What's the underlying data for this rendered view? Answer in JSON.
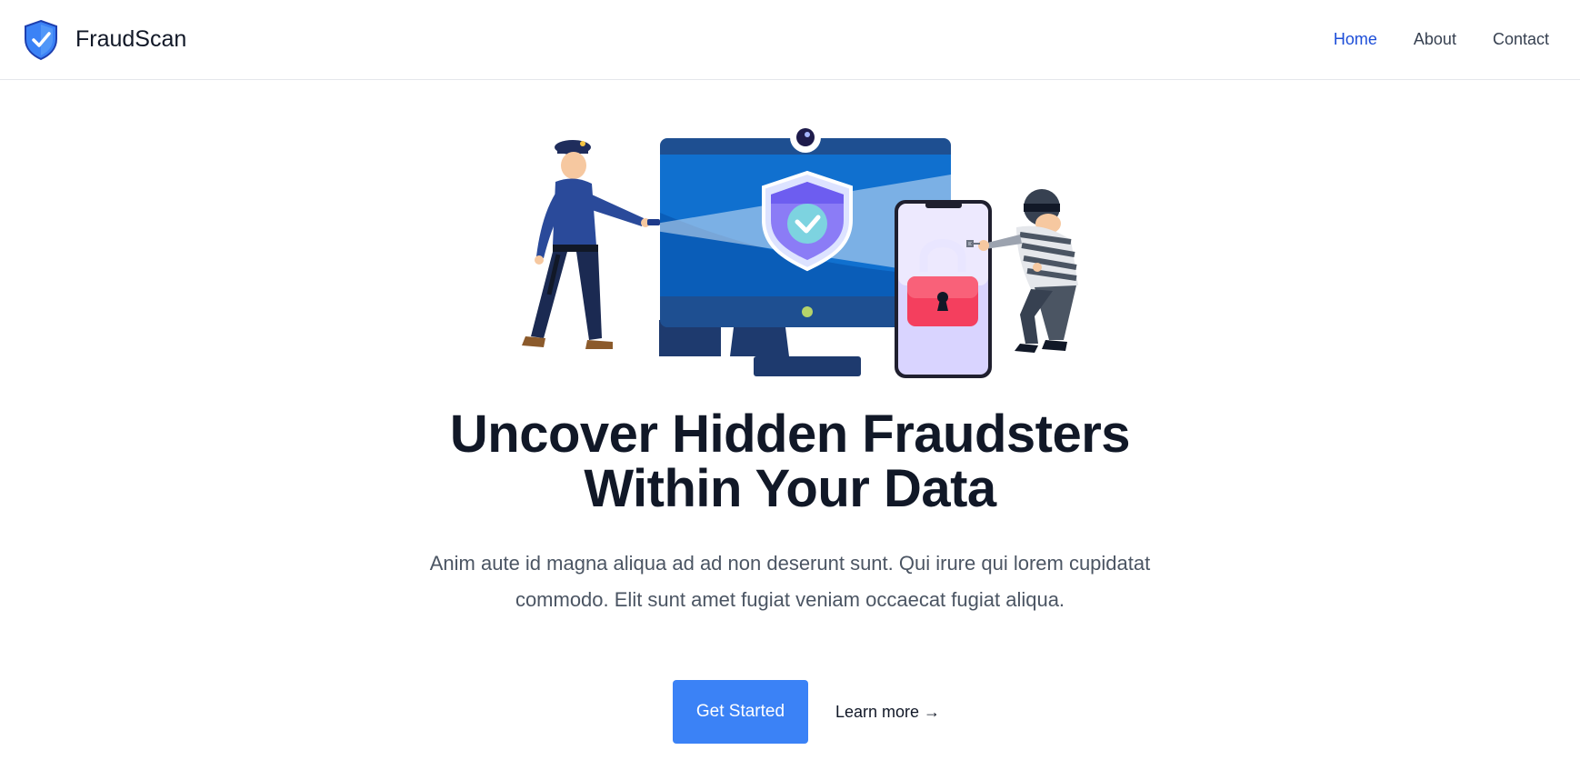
{
  "brand": {
    "name": "FraudScan",
    "logo_icon": "shield-check-icon",
    "accent": "#3b82f6"
  },
  "nav": {
    "items": [
      {
        "label": "Home",
        "active": true
      },
      {
        "label": "About",
        "active": false
      },
      {
        "label": "Contact",
        "active": false
      }
    ],
    "active_color": "#1d4ed8"
  },
  "hero": {
    "illustration": "police-officer-monitor-phone-thief-illustration",
    "title_line1": "Uncover Hidden Fraudsters",
    "title_line2": "Within Your Data",
    "description": "Anim aute id magna aliqua ad ad non deserunt sunt. Qui irure qui lorem cupidatat commodo. Elit sunt amet fugiat veniam occaecat fugiat aliqua.",
    "primary_cta": "Get Started",
    "secondary_cta": "Learn more →"
  },
  "colors": {
    "primary_button": "#3b82f6",
    "title": "#111827",
    "body_text": "#4b5563"
  }
}
